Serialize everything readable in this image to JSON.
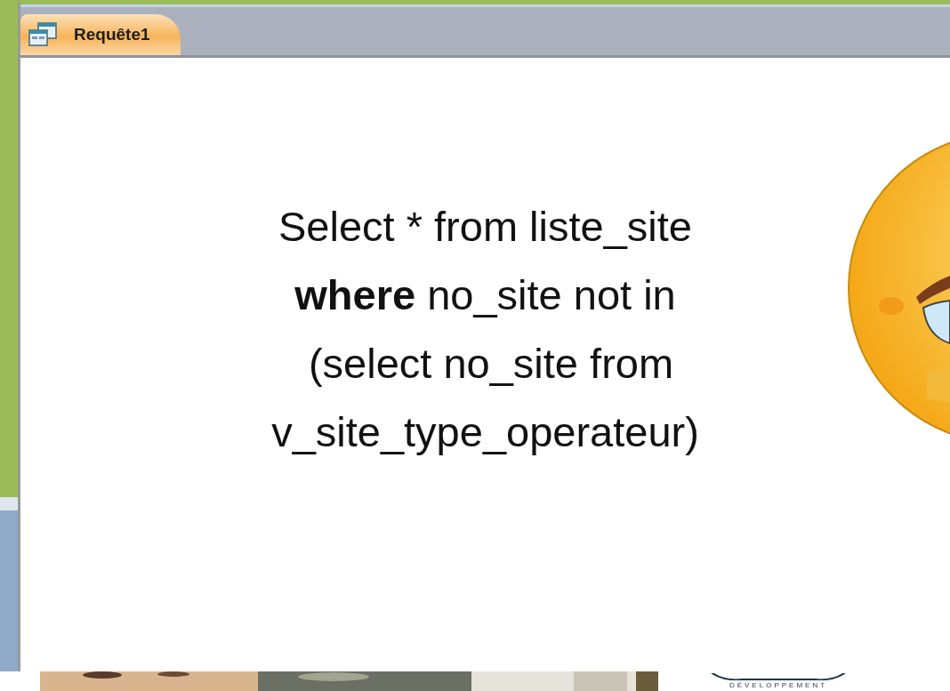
{
  "tab": {
    "label": "Requête1",
    "selected": true
  },
  "query_lines": [
    "Select * from liste_site",
    "**where** no_site not in",
    " (select no_site from",
    "v_site_type_operateur)"
  ],
  "footer": {
    "logo_tagline": "DÉVELOPPEMENT"
  }
}
